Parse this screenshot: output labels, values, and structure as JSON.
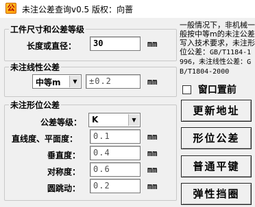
{
  "window": {
    "title": "未注公差查询v0.5 版权：向蔷",
    "icon": "app-icon"
  },
  "group1": {
    "legend": "工件尺寸和公差等级",
    "length_label": "长度或直径：",
    "length_value": "30",
    "unit": "mm"
  },
  "group2": {
    "legend": "未注线性公差",
    "grade_selected": "中等m",
    "result_value": "±0.2",
    "unit": "mm"
  },
  "group3": {
    "legend": "未注形位公差",
    "grade_label": "公差等级：",
    "grade_selected": "K",
    "rows": [
      {
        "label": "直线度、平面度：",
        "value": "0.1",
        "unit": "mm"
      },
      {
        "label": "垂直度：",
        "value": "0.4",
        "unit": "mm"
      },
      {
        "label": "对称度：",
        "value": "0.6",
        "unit": "mm"
      },
      {
        "label": "圆跳动：",
        "value": "0.2",
        "unit": "mm"
      }
    ]
  },
  "note": {
    "line1": "一般情况下，非机械一般按中等m的未注公差写入技术要求，未注形位公差：",
    "line2": "GB/T1184-1996，未注线性公差：",
    "line3": "GB/T1804-2000"
  },
  "checkbox": {
    "label": "窗口置前",
    "checked": false
  },
  "buttons": {
    "update": "更新地址",
    "form_tol": "形位公差",
    "flat_key": "普通平键",
    "retaining_ring": "弹性挡圈"
  }
}
